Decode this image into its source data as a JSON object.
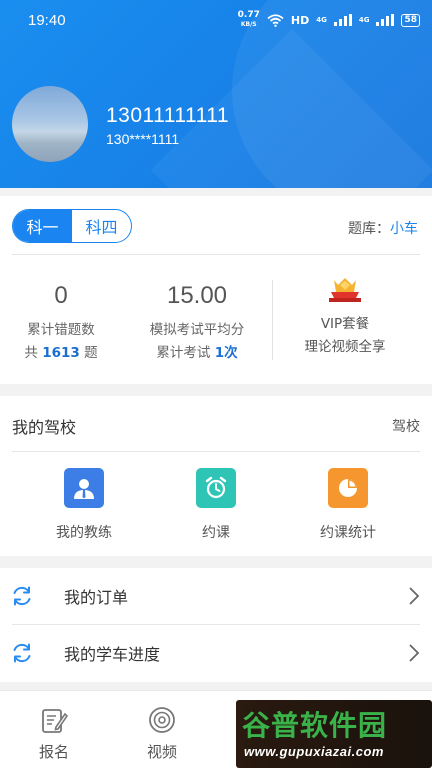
{
  "status_bar": {
    "time": "19:40",
    "net_speed": "0.77",
    "net_unit": "KB/S",
    "hd": "HD",
    "signal1": "4G",
    "signal2": "4G",
    "battery": "58"
  },
  "profile": {
    "phone": "13011111111",
    "phone_masked": "130****1111"
  },
  "subjects": {
    "tabs": [
      "科一",
      "科四"
    ],
    "active": "科一",
    "bank_label": "题库：",
    "bank_value": "小车"
  },
  "stats": {
    "wrong": {
      "value": "0",
      "label": "累计错题数",
      "prefix": "共 ",
      "count": "1613",
      "suffix": " 题"
    },
    "mock": {
      "value": "15.00",
      "label": "模拟考试平均分",
      "prefix": "累计考试 ",
      "count": "1次"
    },
    "vip": {
      "line1": "VIP套餐",
      "line2": "理论视频全享"
    }
  },
  "school": {
    "title": "我的驾校",
    "more": "驾校",
    "items": [
      {
        "label": "我的教练",
        "icon": "coach-icon",
        "color": "#3d7de6"
      },
      {
        "label": "约课",
        "icon": "alarm-clock-icon",
        "color": "#2ec4b6"
      },
      {
        "label": "约课统计",
        "icon": "pie-chart-icon",
        "color": "#f5962e"
      }
    ]
  },
  "menu": {
    "items": [
      {
        "label": "我的订单",
        "icon": "refresh-icon"
      },
      {
        "label": "我的学车进度",
        "icon": "refresh-icon"
      }
    ]
  },
  "nav": {
    "items": [
      {
        "label": "报名",
        "icon": "signup-icon"
      },
      {
        "label": "视频",
        "icon": "video-icon"
      }
    ]
  },
  "watermark": {
    "name": "谷普软件园",
    "url": "www.gupuxiazai.com"
  },
  "colors": {
    "primary": "#1a85f0",
    "accent_blue": "#3d7de6",
    "accent_teal": "#2ec4b6",
    "accent_orange": "#f5962e"
  }
}
